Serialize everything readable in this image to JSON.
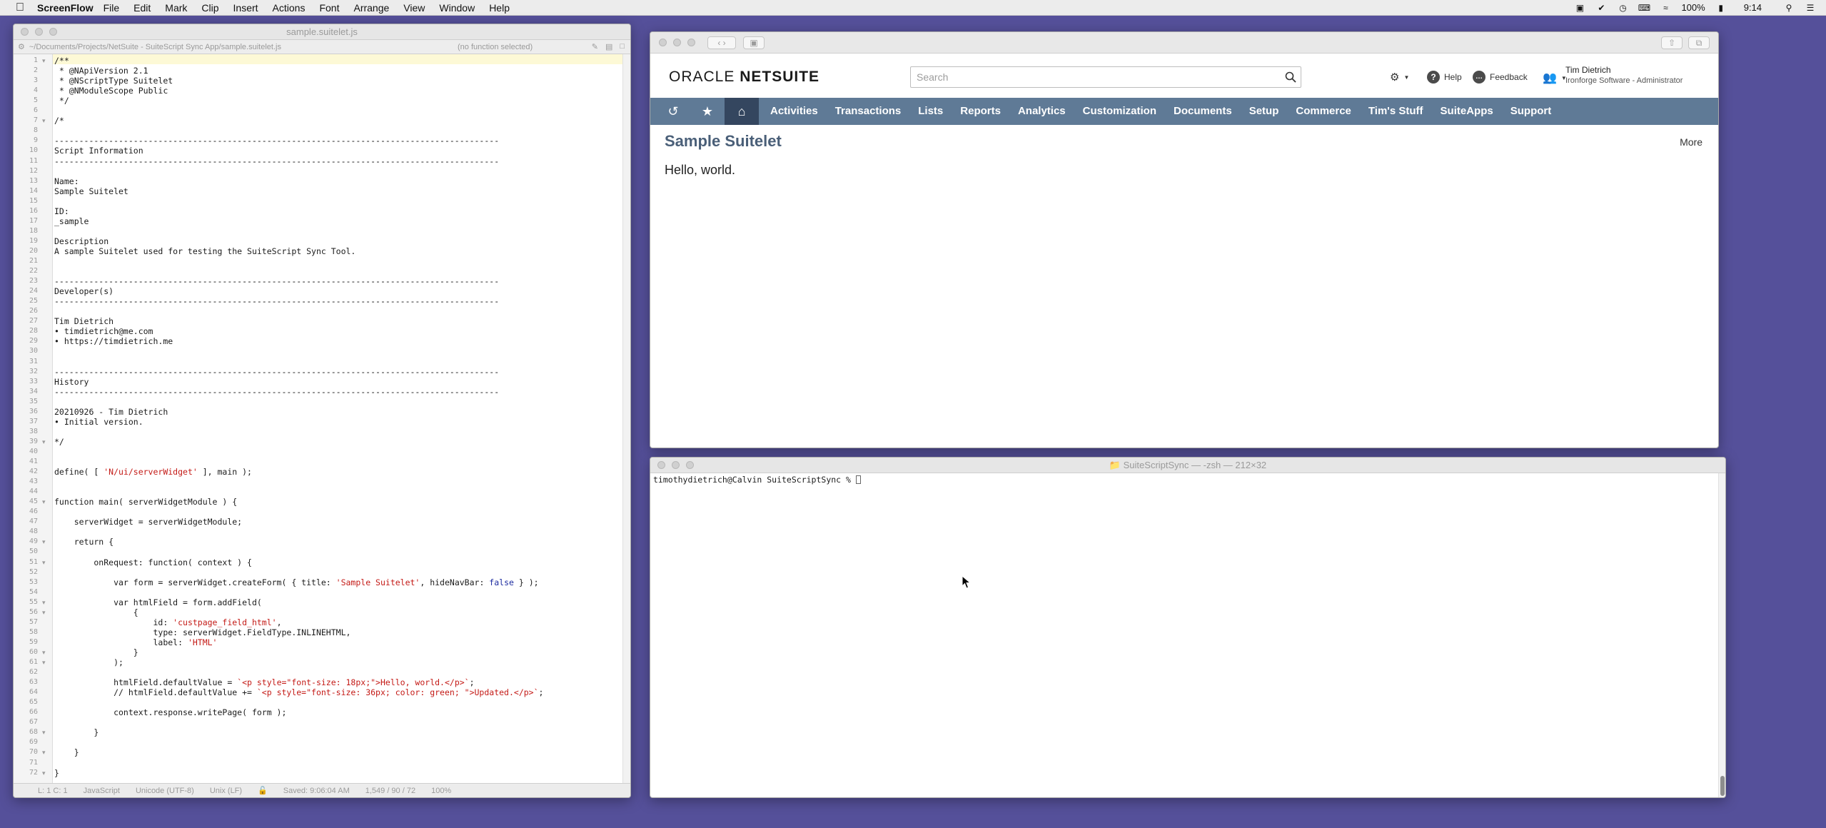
{
  "menubar": {
    "app_name": "ScreenFlow",
    "items": [
      "File",
      "Edit",
      "Mark",
      "Clip",
      "Insert",
      "Actions",
      "Font",
      "Arrange",
      "View",
      "Window",
      "Help"
    ],
    "battery": "100%",
    "time": "9:14"
  },
  "editor": {
    "title": "sample.suitelet.js",
    "path": "~/Documents/Projects/NetSuite - SuiteScript Sync App/sample.suitelet.js",
    "function_selector": "(no function selected)",
    "status": {
      "position": "L: 1 C: 1",
      "language": "JavaScript",
      "encoding": "Unicode (UTF-8)",
      "line_endings": "Unix (LF)",
      "saved": "Saved: 9:06:04 AM",
      "stats": "1,549 / 90 / 72",
      "zoom": "100%"
    },
    "lines": [
      "/**",
      " * @NApiVersion 2.1",
      " * @NScriptType Suitelet",
      " * @NModuleScope Public",
      " */",
      "",
      "/*",
      "",
      "------------------------------------------------------------------------------------------",
      "Script Information",
      "------------------------------------------------------------------------------------------",
      "",
      "Name:",
      "Sample Suitelet",
      "",
      "ID:",
      "_sample",
      "",
      "Description",
      "A sample Suitelet used for testing the SuiteScript Sync Tool.",
      "",
      "",
      "------------------------------------------------------------------------------------------",
      "Developer(s)",
      "------------------------------------------------------------------------------------------",
      "",
      "Tim Dietrich",
      "• timdietrich@me.com",
      "• https://timdietrich.me",
      "",
      "",
      "------------------------------------------------------------------------------------------",
      "History",
      "------------------------------------------------------------------------------------------",
      "",
      "20210926 - Tim Dietrich",
      "• Initial version.",
      "",
      "*/",
      "",
      "",
      "define( [ 'N/ui/serverWidget' ], main );",
      "",
      "",
      "function main( serverWidgetModule ) {",
      "",
      "    serverWidget = serverWidgetModule;",
      "",
      "    return {",
      "",
      "        onRequest: function( context ) {",
      "",
      "            var form = serverWidget.createForm( { title: 'Sample Suitelet', hideNavBar: false } );",
      "",
      "            var htmlField = form.addField(",
      "                {",
      "                    id: 'custpage_field_html',",
      "                    type: serverWidget.FieldType.INLINEHTML,",
      "                    label: 'HTML'",
      "                }",
      "            );",
      "",
      "            htmlField.defaultValue = `<p style=\"font-size: 18px;\">Hello, world.</p>`;",
      "            // htmlField.defaultValue += `<p style=\"font-size: 36px; color: green; \">Updated.</p>`;",
      "",
      "            context.response.writePage( form );",
      "",
      "        }",
      "",
      "    }",
      "",
      "}"
    ],
    "fold_lines": [
      1,
      7,
      39,
      45,
      49,
      51,
      55,
      56,
      60,
      61,
      68,
      70,
      72
    ]
  },
  "browser": {
    "logo_light": "ORACLE ",
    "logo_bold": "NETSUITE",
    "search_placeholder": "Search",
    "help": "Help",
    "feedback": "Feedback",
    "user_name": "Tim Dietrich",
    "user_role": "Ironforge Software - Administrator",
    "nav": [
      "Activities",
      "Transactions",
      "Lists",
      "Reports",
      "Analytics",
      "Customization",
      "Documents",
      "Setup",
      "Commerce",
      "Tim's Stuff",
      "SuiteApps",
      "Support"
    ],
    "page_title": "Sample Suitelet",
    "more": "More",
    "content": "Hello, world."
  },
  "terminal": {
    "title": "SuiteScriptSync — -zsh — 212×32",
    "prompt": "timothydietrich@Calvin SuiteScriptSync % "
  }
}
